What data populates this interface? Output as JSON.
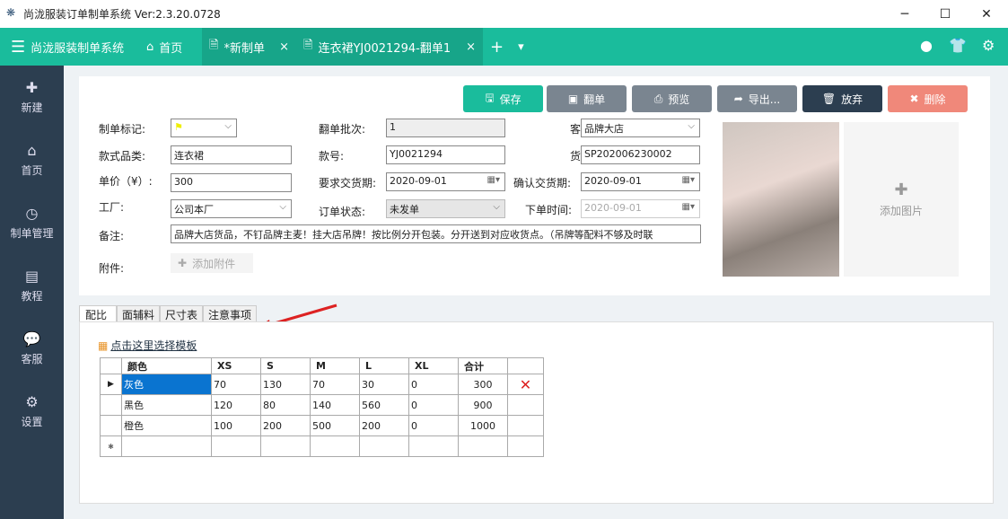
{
  "window": {
    "title": "尚泷服装订单制单系统 Ver:2.3.20.0728"
  },
  "nav": {
    "brand": "尚泷服装制单系统",
    "home": "首页",
    "tabs": [
      {
        "label": "*新制单"
      },
      {
        "label": "连衣裙YJ0021294-翻单1"
      }
    ]
  },
  "sidebar": {
    "items": [
      {
        "label": "新建"
      },
      {
        "label": "首页"
      },
      {
        "label": "制单管理"
      },
      {
        "label": "教程"
      },
      {
        "label": "客服"
      },
      {
        "label": "设置"
      }
    ]
  },
  "toolbar": {
    "save": "保存",
    "copy": "翻单",
    "preview": "预览",
    "export": "导出...",
    "discard": "放弃",
    "delete": "删除"
  },
  "colors": {
    "teal": "#1abc9c",
    "sidebar": "#2c3e50",
    "delete": "#f0887a",
    "discard": "#2c3e50",
    "gray": "#7a8590"
  },
  "form": {
    "mark_label": "制单标记:",
    "batch_label": "翻单批次:",
    "batch": "1",
    "customer_label": "客户:",
    "customer": "品牌大店",
    "category_label": "款式品类:",
    "category": "连衣裙",
    "style_no_label": "款号:",
    "style_no": "YJ0021294",
    "goods_no_label": "货号:",
    "goods_no": "SP202006230002",
    "price_label": "单价（¥）:",
    "price": "300",
    "req_date_label": "要求交货期:",
    "req_date": "2020-09-01",
    "confirm_date_label": "确认交货期:",
    "confirm_date": "2020-09-01",
    "factory_label": "工厂:",
    "factory": "公司本厂",
    "status_label": "订单状态:",
    "status": "未发单",
    "order_time_label": "下单时间:",
    "order_time": "2020-09-01",
    "remark_label": "备注:",
    "remark": "品牌大店货品，不钉品牌主麦！挂大店吊牌！按比例分开包装。分开送到对应收货点。（吊牌等配料不够及时联",
    "attach_label": "附件:",
    "attach_button": "添加附件",
    "add_image": "添加图片"
  },
  "tabs": [
    {
      "label": "配比"
    },
    {
      "label": "面辅料"
    },
    {
      "label": "尺寸表"
    },
    {
      "label": "注意事项"
    }
  ],
  "template_link": "点击这里选择模板",
  "grid": {
    "headers": [
      "颜色",
      "XS",
      "S",
      "M",
      "L",
      "XL",
      "合计"
    ],
    "rows": [
      [
        "灰色",
        "70",
        "130",
        "70",
        "30",
        "0",
        "300"
      ],
      [
        "黑色",
        "120",
        "80",
        "140",
        "560",
        "0",
        "900"
      ],
      [
        "橙色",
        "100",
        "200",
        "500",
        "200",
        "0",
        "1000"
      ]
    ]
  }
}
